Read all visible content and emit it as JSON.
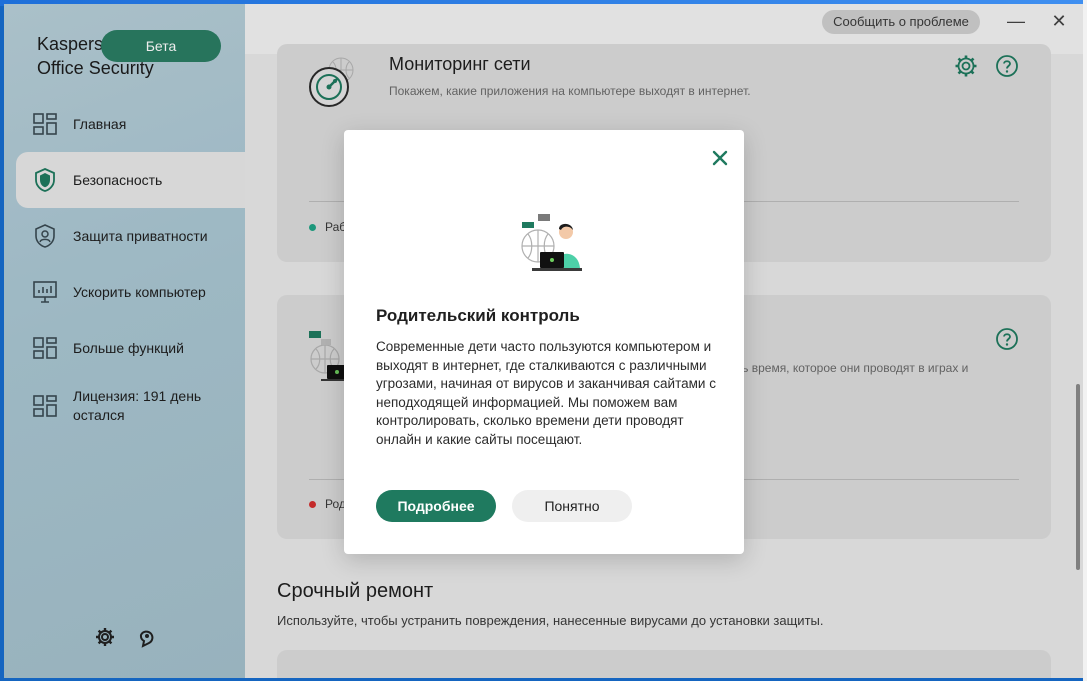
{
  "app": {
    "brand_line1": "Kaspersky",
    "brand_line2": "Office Security",
    "beta_label": "Бета"
  },
  "sidebar": {
    "items": [
      {
        "label": "Главная",
        "icon": "dashboard-icon"
      },
      {
        "label": "Безопасность",
        "icon": "shield-icon"
      },
      {
        "label": "Защита приватности",
        "icon": "privacy-shield-icon"
      },
      {
        "label": "Ускорить компьютер",
        "icon": "monitor-icon"
      },
      {
        "label": "Больше функций",
        "icon": "grid-icon"
      },
      {
        "label": "Лицензия: 191 день остался",
        "icon": "license-icon"
      }
    ],
    "bottom_icons": [
      "gear-icon",
      "support-icon"
    ]
  },
  "topbar": {
    "report_label": "Сообщить о проблеме",
    "minimize": "—",
    "close": "✕"
  },
  "cards": {
    "network": {
      "title": "Мониторинг сети",
      "subtitle": "Покажем, какие приложения на компьютере выходят в интернет.",
      "status": "Раб"
    },
    "parental": {
      "subtitle_partial": "раничить время, которое они проводят в играх и",
      "status": "Род"
    }
  },
  "repair": {
    "title": "Срочный ремонт",
    "subtitle": "Используйте, чтобы устранить повреждения, нанесенные вирусами до установки защиты."
  },
  "modal": {
    "title": "Родительский контроль",
    "body": "Современные дети часто пользуются компьютером и выходят в интернет, где сталкиваются с различными угрозами, начиная от вирусов и заканчивая сайтами с неподходящей информацией. Мы поможем вам контролировать, сколько времени дети проводят онлайн и какие сайты посещают.",
    "primary_label": "Подробнее",
    "secondary_label": "Понятно"
  },
  "colors": {
    "accent": "#1f7a5f",
    "status_ok": "#1fa385",
    "status_warn": "#d32f2f"
  }
}
